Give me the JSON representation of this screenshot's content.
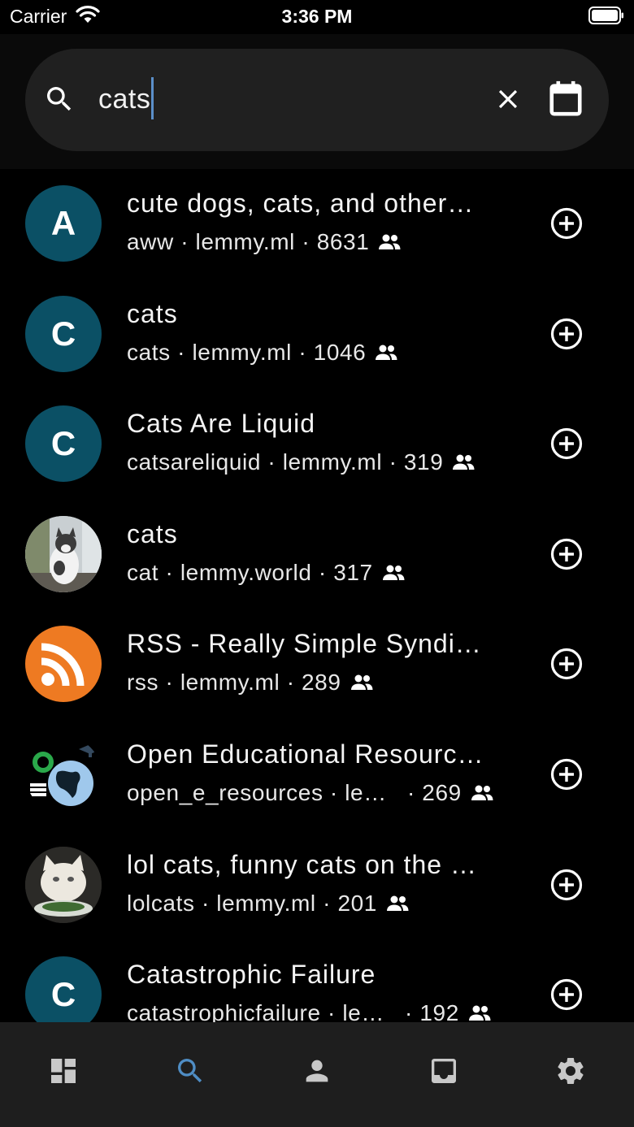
{
  "status_bar": {
    "carrier": "Carrier",
    "time": "3:36 PM"
  },
  "search": {
    "query": "cats"
  },
  "results": [
    {
      "title": "cute dogs, cats, and other…",
      "name": "aww",
      "instance": "lemmy.ml",
      "subscribers": "8631",
      "avatar_letter": "A",
      "avatar_kind": "letter"
    },
    {
      "title": "cats",
      "name": "cats",
      "instance": "lemmy.ml",
      "subscribers": "1046",
      "avatar_letter": "C",
      "avatar_kind": "letter"
    },
    {
      "title": "Cats Are Liquid",
      "name": "catsareliquid",
      "instance": "lemmy.ml",
      "subscribers": "319",
      "avatar_letter": "C",
      "avatar_kind": "letter"
    },
    {
      "title": "cats",
      "name": "cat",
      "instance": "lemmy.world",
      "subscribers": "317",
      "avatar_kind": "photo-cat"
    },
    {
      "title": "RSS - Really Simple Syndi…",
      "name": "rss",
      "instance": "lemmy.ml",
      "subscribers": "289",
      "avatar_kind": "rss"
    },
    {
      "title": "Open Educational Resourc…",
      "name": "open_e_resources",
      "instance": "le…",
      "subscribers": "269",
      "avatar_kind": "oer"
    },
    {
      "title": "lol cats, funny cats on the …",
      "name": "lolcats",
      "instance": "lemmy.ml",
      "subscribers": "201",
      "avatar_kind": "photo-lolcat"
    },
    {
      "title": "Catastrophic Failure",
      "name": "catastrophicfailure",
      "instance": "le…",
      "subscribers": "192",
      "avatar_letter": "C",
      "avatar_kind": "letter"
    }
  ],
  "colors": {
    "avatar_bg": "#0b5065",
    "accent": "#4f8dc4",
    "rss": "#ee7a22"
  },
  "icons": {
    "search": "search-icon",
    "clear": "close-icon",
    "calendar": "calendar-icon",
    "add": "add-circle-icon",
    "people": "people-icon",
    "nav": [
      "dashboard-icon",
      "search-icon",
      "person-icon",
      "inbox-icon",
      "gear-icon"
    ]
  },
  "bottom_nav": {
    "active": "search"
  }
}
